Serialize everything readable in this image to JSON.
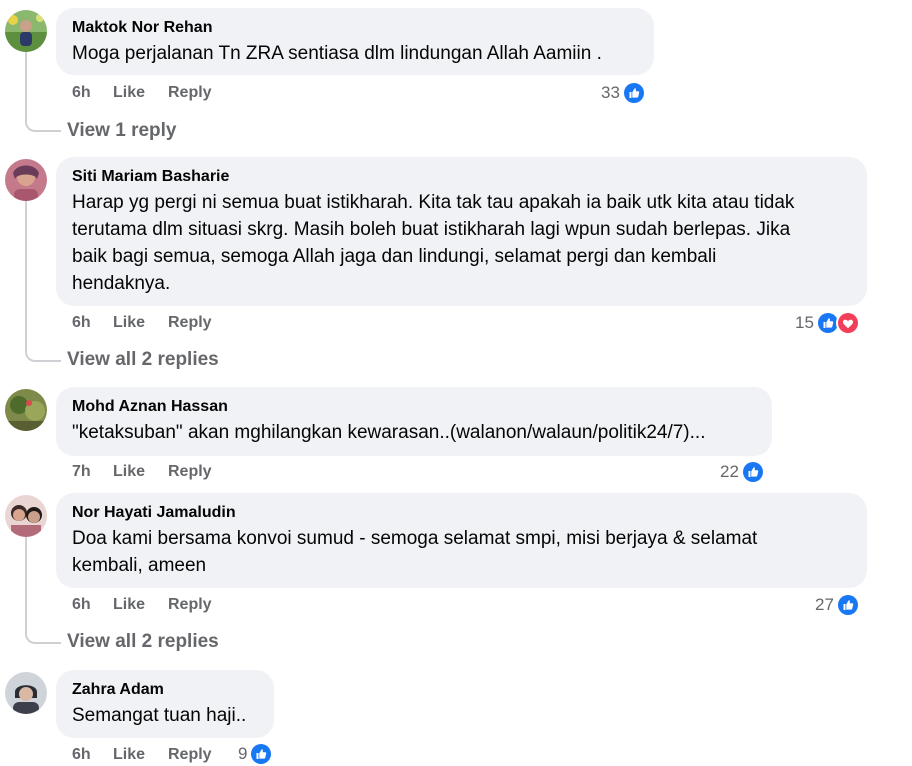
{
  "comments": [
    {
      "author": "Maktok Nor Rehan",
      "text": "Moga perjalanan Tn ZRA sentiasa dlm lindungan Allah Aamiin .",
      "time": "6h",
      "like_label": "Like",
      "reply_label": "Reply",
      "reaction_count": "33",
      "reactions": [
        "like-icon"
      ],
      "view_replies": "View 1 reply"
    },
    {
      "author": "Siti Mariam Basharie",
      "text_lines": [
        "Harap yg pergi ni semua buat istikharah. Kita tak tau apakah ia baik utk kita atau tidak",
        "terutama dlm situasi skrg. Masih boleh buat istikharah lagi wpun sudah berlepas. Jika",
        "baik bagi semua, semoga Allah jaga dan lindungi, selamat pergi dan kembali",
        "hendaknya."
      ],
      "time": "6h",
      "like_label": "Like",
      "reply_label": "Reply",
      "reaction_count": "15",
      "reactions": [
        "like-icon",
        "love-icon"
      ],
      "view_replies": "View all 2 replies"
    },
    {
      "author": "Mohd Aznan Hassan",
      "text": "\"ketaksuban\" akan mghilangkan kewarasan..(walanon/walaun/politik24/7)...",
      "time": "7h",
      "like_label": "Like",
      "reply_label": "Reply",
      "reaction_count": "22",
      "reactions": [
        "like-icon"
      ]
    },
    {
      "author": "Nor Hayati Jamaludin",
      "text_lines": [
        "Doa kami bersama konvoi sumud - semoga selamat smpi, misi berjaya & selamat",
        "kembali, ameen"
      ],
      "time": "6h",
      "like_label": "Like",
      "reply_label": "Reply",
      "reaction_count": "27",
      "reactions": [
        "like-icon"
      ],
      "view_replies": "View all 2 replies"
    },
    {
      "author": "Zahra Adam",
      "text": "Semangat tuan haji..",
      "time": "6h",
      "like_label": "Like",
      "reply_label": "Reply",
      "reaction_count": "9",
      "reactions": [
        "like-icon"
      ]
    }
  ],
  "colors": {
    "bubble": "#f0f2f5",
    "meta_text": "#65676b",
    "like_blue": "#1877f2",
    "love_red": "#f33e58"
  }
}
